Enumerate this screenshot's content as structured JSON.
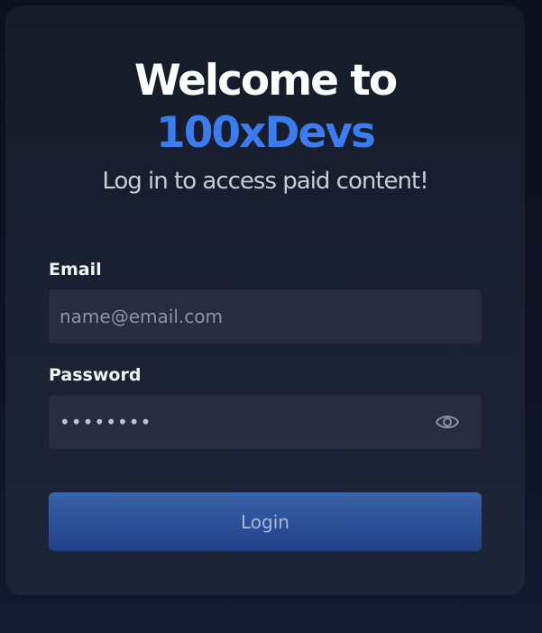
{
  "header": {
    "title": "Welcome to",
    "brand": "100xDevs",
    "subtitle": "Log in to access paid content!"
  },
  "form": {
    "email": {
      "label": "Email",
      "placeholder": "name@email.com",
      "value": ""
    },
    "password": {
      "label": "Password",
      "value": "••••••••",
      "toggle_icon": "eye-icon"
    },
    "login_label": "Login"
  },
  "colors": {
    "brand": "#3b7df0",
    "button": "#2c4f98",
    "field_background": "#272d3e",
    "card_background": "#1a2133"
  }
}
